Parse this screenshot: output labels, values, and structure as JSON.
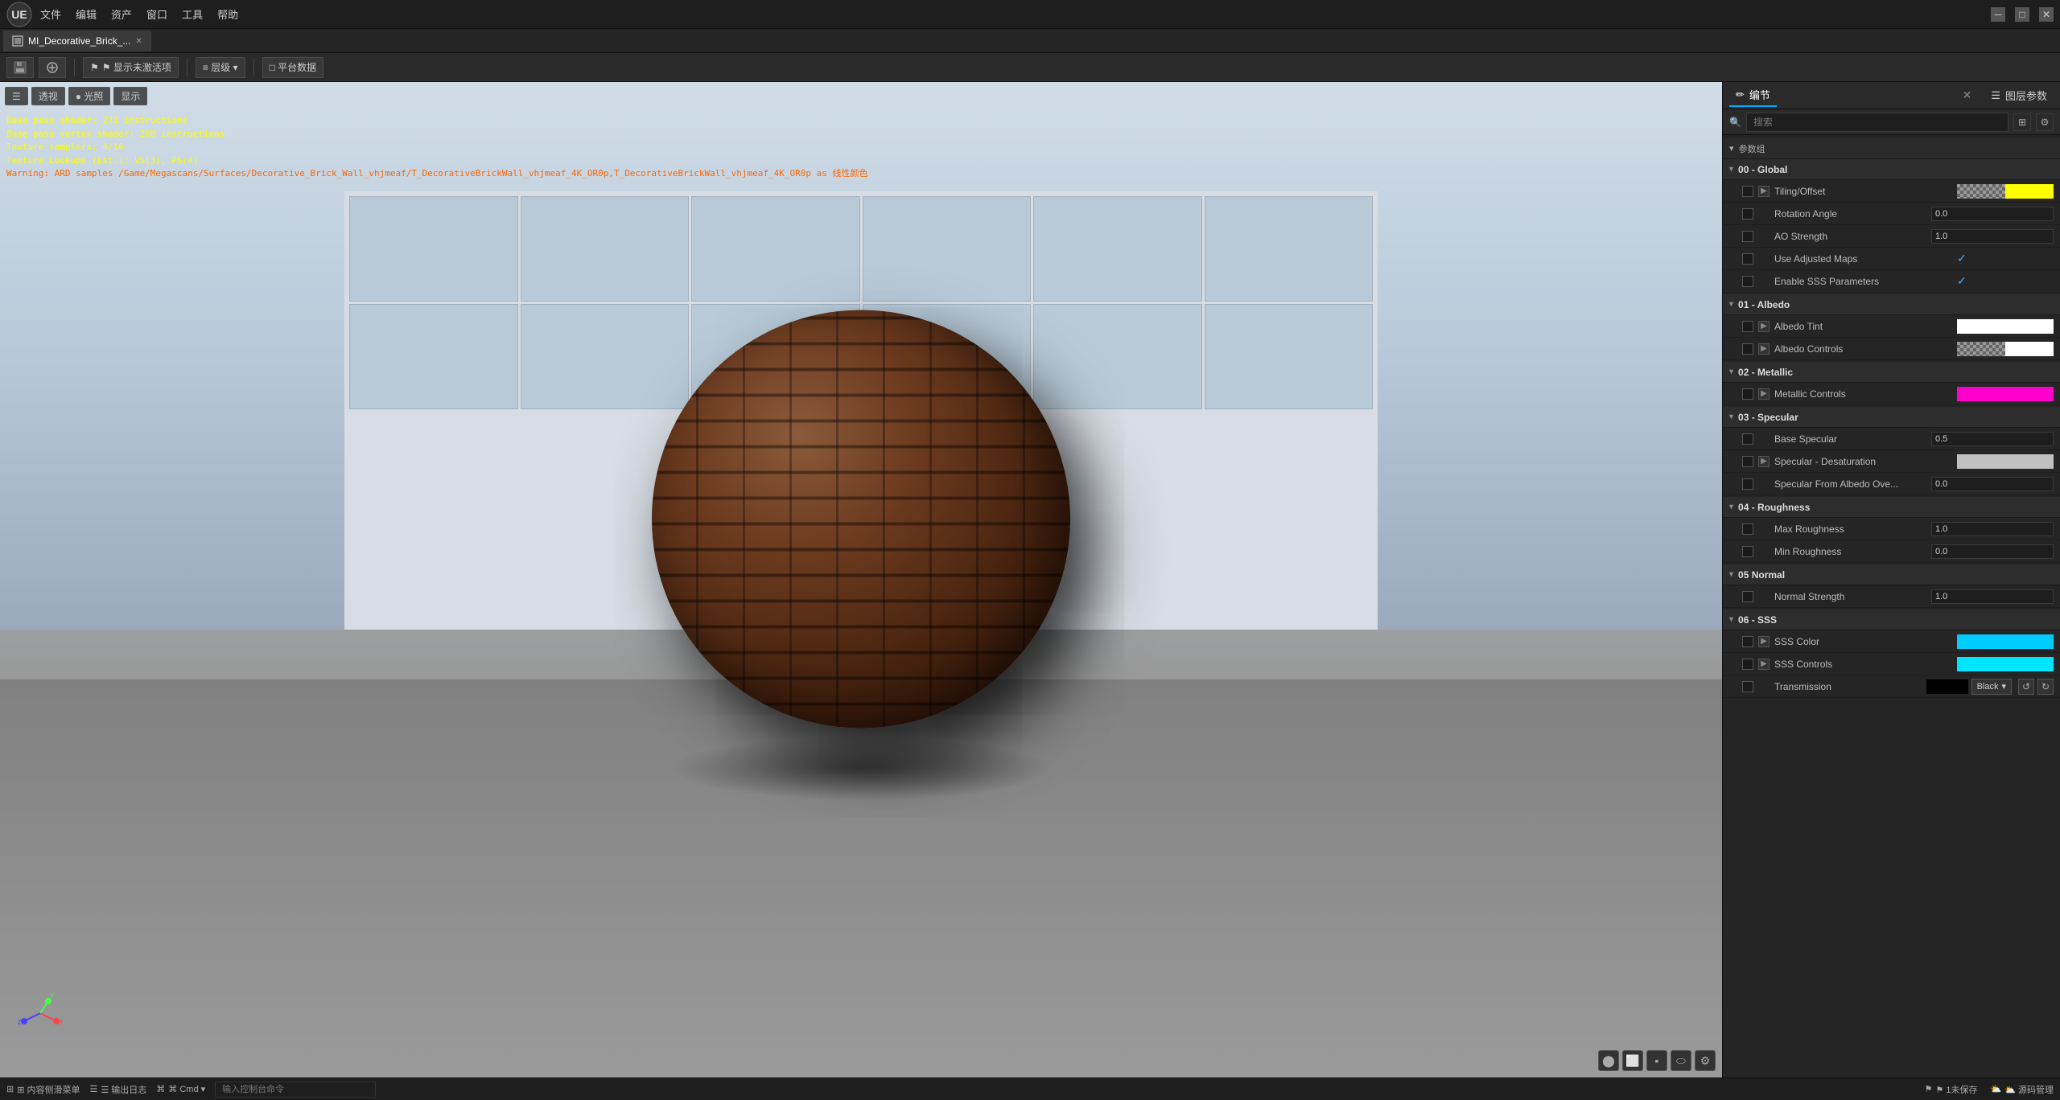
{
  "window": {
    "title": "MI_Decorative_Brick_...",
    "close": "✕",
    "minimize": "─",
    "maximize": "□"
  },
  "menu": {
    "items": [
      "文件",
      "编辑",
      "资产",
      "窗口",
      "工具",
      "帮助"
    ]
  },
  "tabs": {
    "active_tab": "MI_Decorative_Brick_...",
    "close_label": "✕"
  },
  "toolbar": {
    "save_label": "⬛",
    "display_inactive": "⚑ 显示未激活项",
    "layers": "≡ 层级 ▾",
    "platform": "□ 平台数据"
  },
  "viewport": {
    "mode_perspective": "透视",
    "mode_lighting": "光照",
    "mode_display": "显示",
    "overlay_line1": "Base pass shader: 271 instructions",
    "overlay_line2": "Base pass vertex shader: 260 instructions",
    "overlay_line3": "Texture samplers: 4/16",
    "overlay_line4": "Texture Lookups (Est.): VS(3), PS(4)",
    "overlay_warning": "Warning: ARD samples /Game/Megascans/Surfaces/Decorative_Brick_Wall_vhjmeaf/T_DecorativeBrickWall_vhjmeaf_4K_OR0p,T_DecorativeBrickWall_vhjmeaf_4K_OR0p as 线性颜色"
  },
  "right_panel": {
    "tab_editor": "✏ 编节",
    "tab_layers": "☰ 图层参数",
    "search_placeholder": "搜索",
    "params_section": "参数组",
    "sections": [
      {
        "id": "global",
        "label": "00 - Global",
        "params": [
          {
            "name": "Tiling/Offset",
            "type": "color_swatch",
            "has_expand": true,
            "swatch_left": "checker",
            "swatch_right": "#ffff00"
          },
          {
            "name": "Rotation Angle",
            "type": "number",
            "value": "0.0"
          },
          {
            "name": "AO Strength",
            "type": "number",
            "value": "1.0"
          },
          {
            "name": "Use Adjusted Maps",
            "type": "checkbox",
            "checked": true
          },
          {
            "name": "Enable SSS Parameters",
            "type": "checkbox",
            "checked": true
          }
        ]
      },
      {
        "id": "albedo",
        "label": "01 - Albedo",
        "params": [
          {
            "name": "Albedo Tint",
            "type": "color_swatch",
            "has_expand": true,
            "swatch_left": "solid_white",
            "swatch_right": "solid_white"
          },
          {
            "name": "Albedo Controls",
            "type": "color_swatch",
            "has_expand": true,
            "swatch_left": "checker",
            "swatch_right": "solid_white"
          }
        ]
      },
      {
        "id": "metallic",
        "label": "02 - Metallic",
        "params": [
          {
            "name": "Metallic Controls",
            "type": "color_swatch",
            "has_expand": true,
            "swatch_left": "solid_magenta",
            "swatch_right": "solid_magenta"
          }
        ]
      },
      {
        "id": "specular",
        "label": "03 - Specular",
        "params": [
          {
            "name": "Base Specular",
            "type": "number",
            "value": "0.5"
          },
          {
            "name": "Specular - Desaturation",
            "type": "color_swatch",
            "has_expand": true,
            "swatch_left": "solid_lightgray",
            "swatch_right": "solid_lightgray"
          },
          {
            "name": "Specular From Albedo Ove...",
            "type": "number",
            "value": "0.0"
          }
        ]
      },
      {
        "id": "roughness",
        "label": "04 - Roughness",
        "params": [
          {
            "name": "Max Roughness",
            "type": "number",
            "value": "1.0"
          },
          {
            "name": "Min Roughness",
            "type": "number",
            "value": "0.0"
          }
        ]
      },
      {
        "id": "normal",
        "label": "05 Normal",
        "params": [
          {
            "name": "Normal Strength",
            "type": "number",
            "value": "1.0"
          }
        ]
      },
      {
        "id": "sss",
        "label": "06 - SSS",
        "params": [
          {
            "name": "SSS Color",
            "type": "color_swatch",
            "has_expand": true,
            "swatch_left": "solid_cyan",
            "swatch_right": "solid_cyan"
          },
          {
            "name": "SSS Controls",
            "type": "color_swatch",
            "has_expand": true,
            "swatch_left": "solid_cyan2",
            "swatch_right": "solid_cyan2"
          },
          {
            "name": "Transmission",
            "type": "transmission"
          }
        ]
      }
    ],
    "transmission_label": "Transmission",
    "black_label": "Black",
    "dropdown_arrow": "▾"
  },
  "status_bar": {
    "content_browser": "⊞ 内容侧滑菜单",
    "output_log": "☰ 输出日志",
    "cmd": "⌘ Cmd ▾",
    "cmd_input_placeholder": "输入控制台命令",
    "right_items": {
      "unsaved": "⚑ 1未保存",
      "source_control": "⛅ 源码管理"
    }
  },
  "colors": {
    "accent_blue": "#00aaff",
    "accent_yellow": "#ffff00",
    "accent_magenta": "#ff00cc",
    "accent_cyan": "#00ccff",
    "background_dark": "#1e1e1e",
    "background_panel": "#252525"
  }
}
